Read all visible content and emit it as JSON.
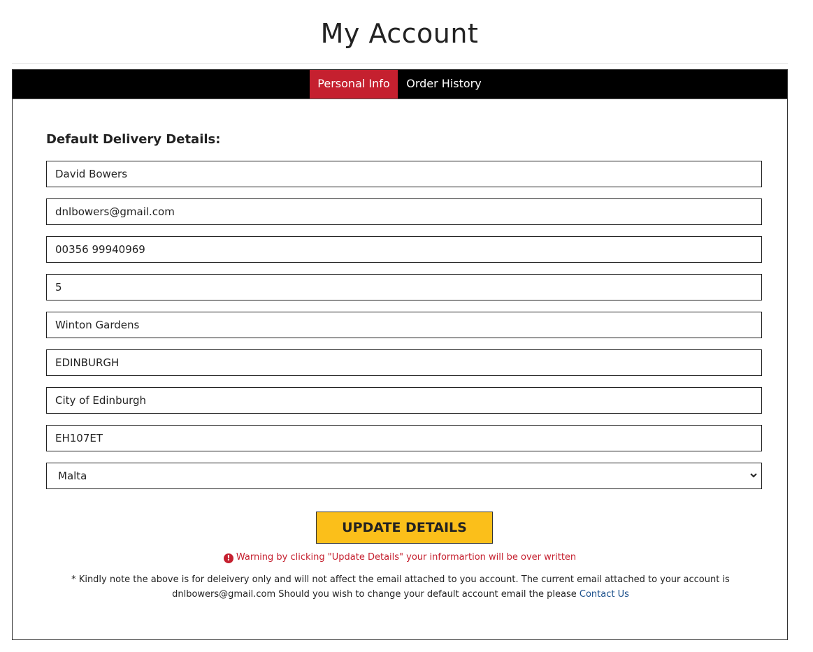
{
  "page": {
    "title": "My Account"
  },
  "tabs": [
    {
      "label": "Personal Info",
      "active": true
    },
    {
      "label": "Order History",
      "active": false
    }
  ],
  "form": {
    "heading": "Default Delivery Details:",
    "fields": {
      "name": "David Bowers",
      "email": "dnlbowers@gmail.com",
      "phone": "00356 99940969",
      "house": "5",
      "street": "Winton Gardens",
      "city": "EDINBURGH",
      "county": "City of Edinburgh",
      "postcode": "EH107ET"
    },
    "country": {
      "selected": "Malta"
    },
    "submit_label": "UPDATE DETAILS"
  },
  "warning": {
    "icon": "exclamation-circle-icon",
    "text": "Warning by clicking \"Update Details\" your informartion will be over written"
  },
  "note": {
    "line1": "* Kindly note the above is for deleivery only and will not affect the email attached to you account. The current email attached to your account is",
    "line2": "dnlbowers@gmail.com Should you wish to change your default account email the please",
    "link_label": "Contact Us"
  },
  "colors": {
    "accent_red": "#c5202f",
    "tabbar_bg": "#000000",
    "button_yellow": "#fbbf1a",
    "link_blue": "#1a4f8b"
  }
}
